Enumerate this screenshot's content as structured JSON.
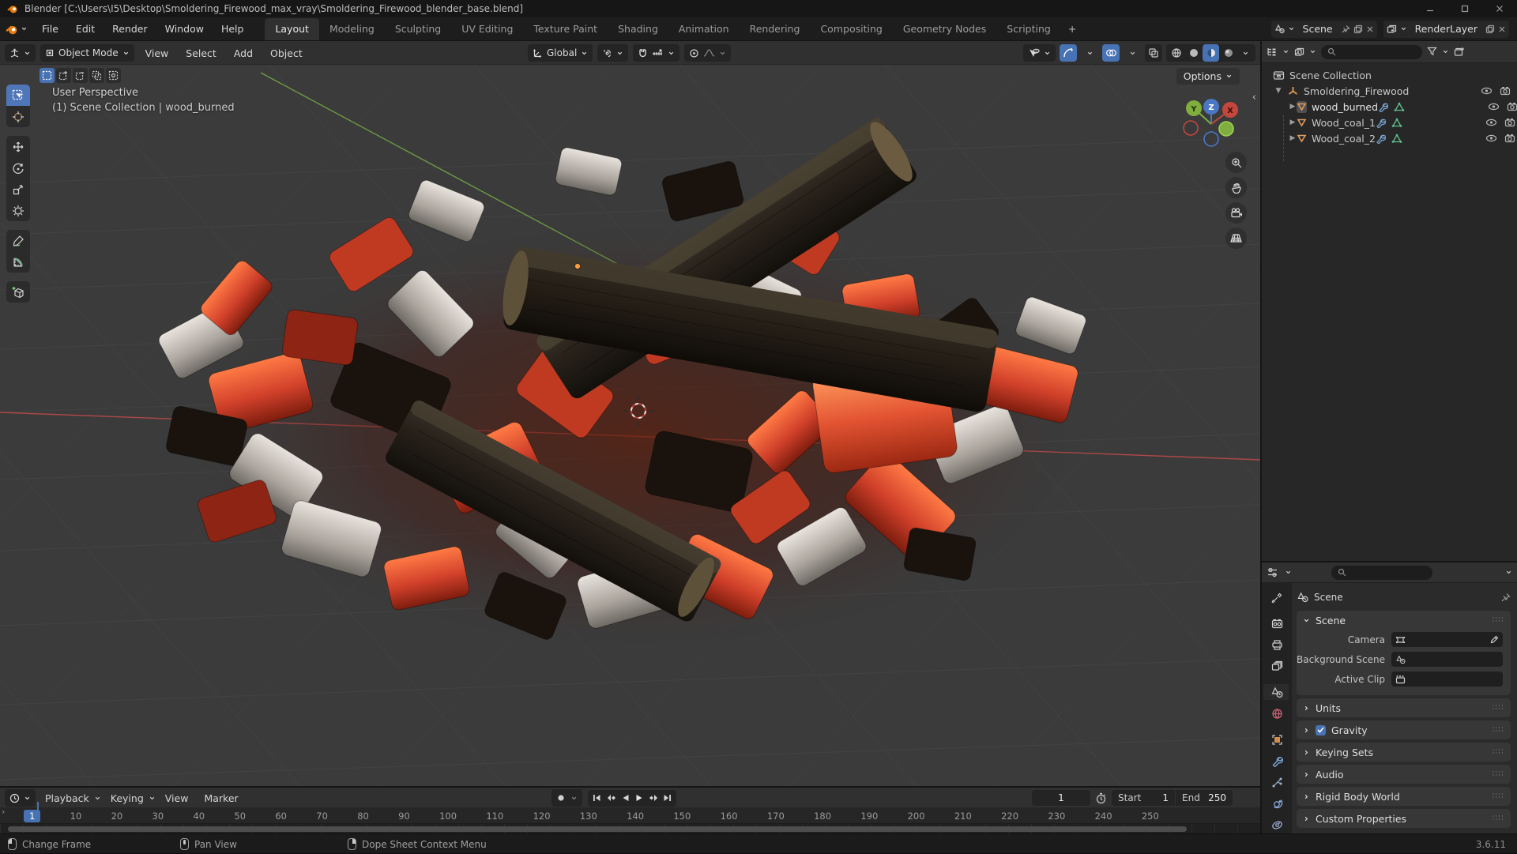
{
  "window": {
    "title": "Blender [C:\\Users\\I5\\Desktop\\Smoldering_Firewood_max_vray\\Smoldering_Firewood_blender_base.blend]"
  },
  "topbar": {
    "menus": [
      "File",
      "Edit",
      "Render",
      "Window",
      "Help"
    ],
    "tabs": [
      "Layout",
      "Modeling",
      "Sculpting",
      "UV Editing",
      "Texture Paint",
      "Shading",
      "Animation",
      "Rendering",
      "Compositing",
      "Geometry Nodes",
      "Scripting"
    ],
    "active_tab": "Layout",
    "new_tab": "+",
    "scene_selector": {
      "value": "Scene"
    },
    "render_layer_selector": {
      "value": "RenderLayer"
    }
  },
  "viewport": {
    "header": {
      "mode": "Object Mode",
      "menu_view": "View",
      "menu_select": "Select",
      "menu_add": "Add",
      "menu_object": "Object",
      "orientation": "Global",
      "options_label": "Options"
    },
    "overlay": {
      "perspective_label": "User Perspective",
      "context_label": "(1) Scene Collection | wood_burned"
    },
    "gizmo_axes": {
      "x": "X",
      "y": "Y",
      "z": "Z"
    },
    "tools": [
      "Select Box",
      "Cursor",
      "Move",
      "Rotate",
      "Scale",
      "Transform",
      "Annotate",
      "Measure",
      "Add Cube"
    ]
  },
  "outliner": {
    "root": "Scene Collection",
    "collection": "Smoldering_Firewood",
    "objects": [
      "wood_burned",
      "Wood_coal_1",
      "Wood_coal_2"
    ],
    "search_value": ""
  },
  "properties": {
    "breadcrumb": "Scene",
    "search_value": "",
    "scene_panel": {
      "title": "Scene",
      "camera_label": "Camera",
      "background_label": "Background Scene",
      "clip_label": "Active Clip"
    },
    "collapsed_panels": [
      "Units",
      "Gravity",
      "Keying Sets",
      "Audio",
      "Rigid Body World",
      "Custom Properties"
    ]
  },
  "timeline": {
    "menu_playback": "Playback",
    "menu_keying": "Keying",
    "menu_view": "View",
    "menu_marker": "Marker",
    "current_frame": "1",
    "start_label": "Start",
    "start_value": "1",
    "end_label": "End",
    "end_value": "250",
    "ticks": [
      "1",
      "10",
      "20",
      "30",
      "40",
      "50",
      "60",
      "70",
      "80",
      "90",
      "100",
      "110",
      "120",
      "130",
      "140",
      "150",
      "160",
      "170",
      "180",
      "190",
      "200",
      "210",
      "220",
      "230",
      "240",
      "250"
    ]
  },
  "statusbar": {
    "items": [
      {
        "icon": "mouse-left",
        "label": "Change Frame"
      },
      {
        "icon": "mouse-middle",
        "label": "Pan View"
      },
      {
        "icon": "mouse-right",
        "label": "Dope Sheet Context Menu"
      }
    ],
    "version": "3.6.11"
  },
  "colors": {
    "accent_blue": "#4772b3",
    "logo_orange": "#e87d0d",
    "mesh_orange": "#dd9c5f",
    "modifier_blue": "#7aa5d4",
    "data_green": "#62c48e",
    "axis_red": "#b04848",
    "axis_green": "#6d9b44",
    "viewport_bg": "#3b3b3b"
  }
}
